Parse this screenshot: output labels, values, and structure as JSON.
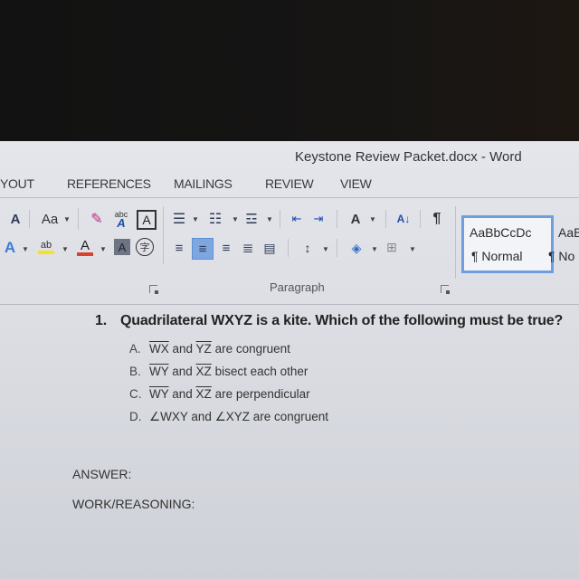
{
  "window": {
    "title": "Keystone Review Packet.docx - Word"
  },
  "ribbon_tabs": [
    {
      "label": "YOUT"
    },
    {
      "label": "REFERENCES"
    },
    {
      "label": "MAILINGS"
    },
    {
      "label": "REVIEW"
    },
    {
      "label": "VIEW"
    }
  ],
  "font_group": {
    "font_size_label": "A",
    "change_case_label": "Aa",
    "text_effects_label": "A",
    "font_color_label": "A",
    "char_shading_label": "A",
    "enclose_char_label": "字",
    "highlight_label": "ab",
    "phonetic_label": "abc",
    "char_border_label": "A",
    "highlight_color": "#f5e12a",
    "font_color": "#d9432b"
  },
  "paragraph_group": {
    "label": "Paragraph",
    "sort_label": "A↓",
    "pilcrow": "¶",
    "active_alignment": "center"
  },
  "styles_group": {
    "items": [
      {
        "sample": "AaBbCcDc",
        "name": "¶ Normal",
        "selected": true
      },
      {
        "sample": "AaB",
        "name": "¶ No",
        "selected": false
      }
    ]
  },
  "document": {
    "question": {
      "number": "1.",
      "text": "Quadrilateral WXYZ is a kite.  Which of the following must be true?"
    },
    "choices": [
      {
        "letter": "A.",
        "seg1": "WX",
        "mid": " and ",
        "seg2": "YZ",
        "rest": " are congruent",
        "type": "segment"
      },
      {
        "letter": "B.",
        "seg1": "WY",
        "mid": " and ",
        "seg2": "XZ",
        "rest": " bisect each other",
        "type": "segment"
      },
      {
        "letter": "C.",
        "seg1": "WY",
        "mid": " and ",
        "seg2": "XZ",
        "rest": " are perpendicular",
        "type": "segment"
      },
      {
        "letter": "D.",
        "seg1": "∠WXY",
        "mid": " and ",
        "seg2": "∠XYZ",
        "rest": " are congruent",
        "type": "angle"
      }
    ],
    "answer_label": "ANSWER:",
    "work_label": "WORK/REASONING:"
  }
}
